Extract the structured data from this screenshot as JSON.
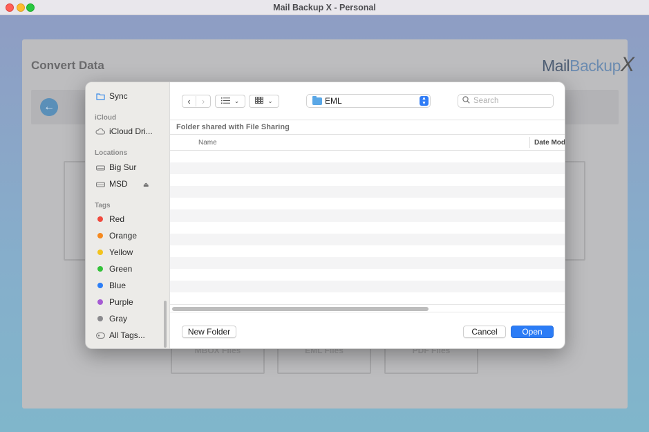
{
  "window": {
    "title": "Mail Backup X - Personal"
  },
  "app": {
    "panel_title": "Convert Data",
    "logo": {
      "part1": "Mail",
      "part2": "Backup",
      "part3": "X"
    },
    "options": [
      "MBOX Files",
      "EML Files",
      "PDF Files"
    ]
  },
  "dialog": {
    "sidebar": {
      "favorites": [
        {
          "label": "Sync",
          "icon": "folder-icon"
        }
      ],
      "icloud_header": "iCloud",
      "icloud": [
        {
          "label": "iCloud Dri...",
          "icon": "cloud-icon"
        }
      ],
      "locations_header": "Locations",
      "locations": [
        {
          "label": "Big Sur",
          "icon": "drive-icon"
        },
        {
          "label": "MSD",
          "icon": "drive-icon",
          "ejectable": true
        }
      ],
      "tags_header": "Tags",
      "tags": [
        {
          "label": "Red",
          "color": "#f04a3e"
        },
        {
          "label": "Orange",
          "color": "#f5891f"
        },
        {
          "label": "Yellow",
          "color": "#f3c31c"
        },
        {
          "label": "Green",
          "color": "#34c23a"
        },
        {
          "label": "Blue",
          "color": "#2c7ef6"
        },
        {
          "label": "Purple",
          "color": "#a55bd3"
        },
        {
          "label": "Gray",
          "color": "#8a8a8d"
        }
      ],
      "all_tags": "All Tags..."
    },
    "toolbar": {
      "current_folder": "EML",
      "search_placeholder": "Search"
    },
    "breadcrumb": "Folder shared with File Sharing",
    "columns": {
      "name": "Name",
      "date": "Date Mod"
    },
    "buttons": {
      "new_folder": "New Folder",
      "cancel": "Cancel",
      "open": "Open"
    },
    "accent_color": "#2b7cf6"
  }
}
